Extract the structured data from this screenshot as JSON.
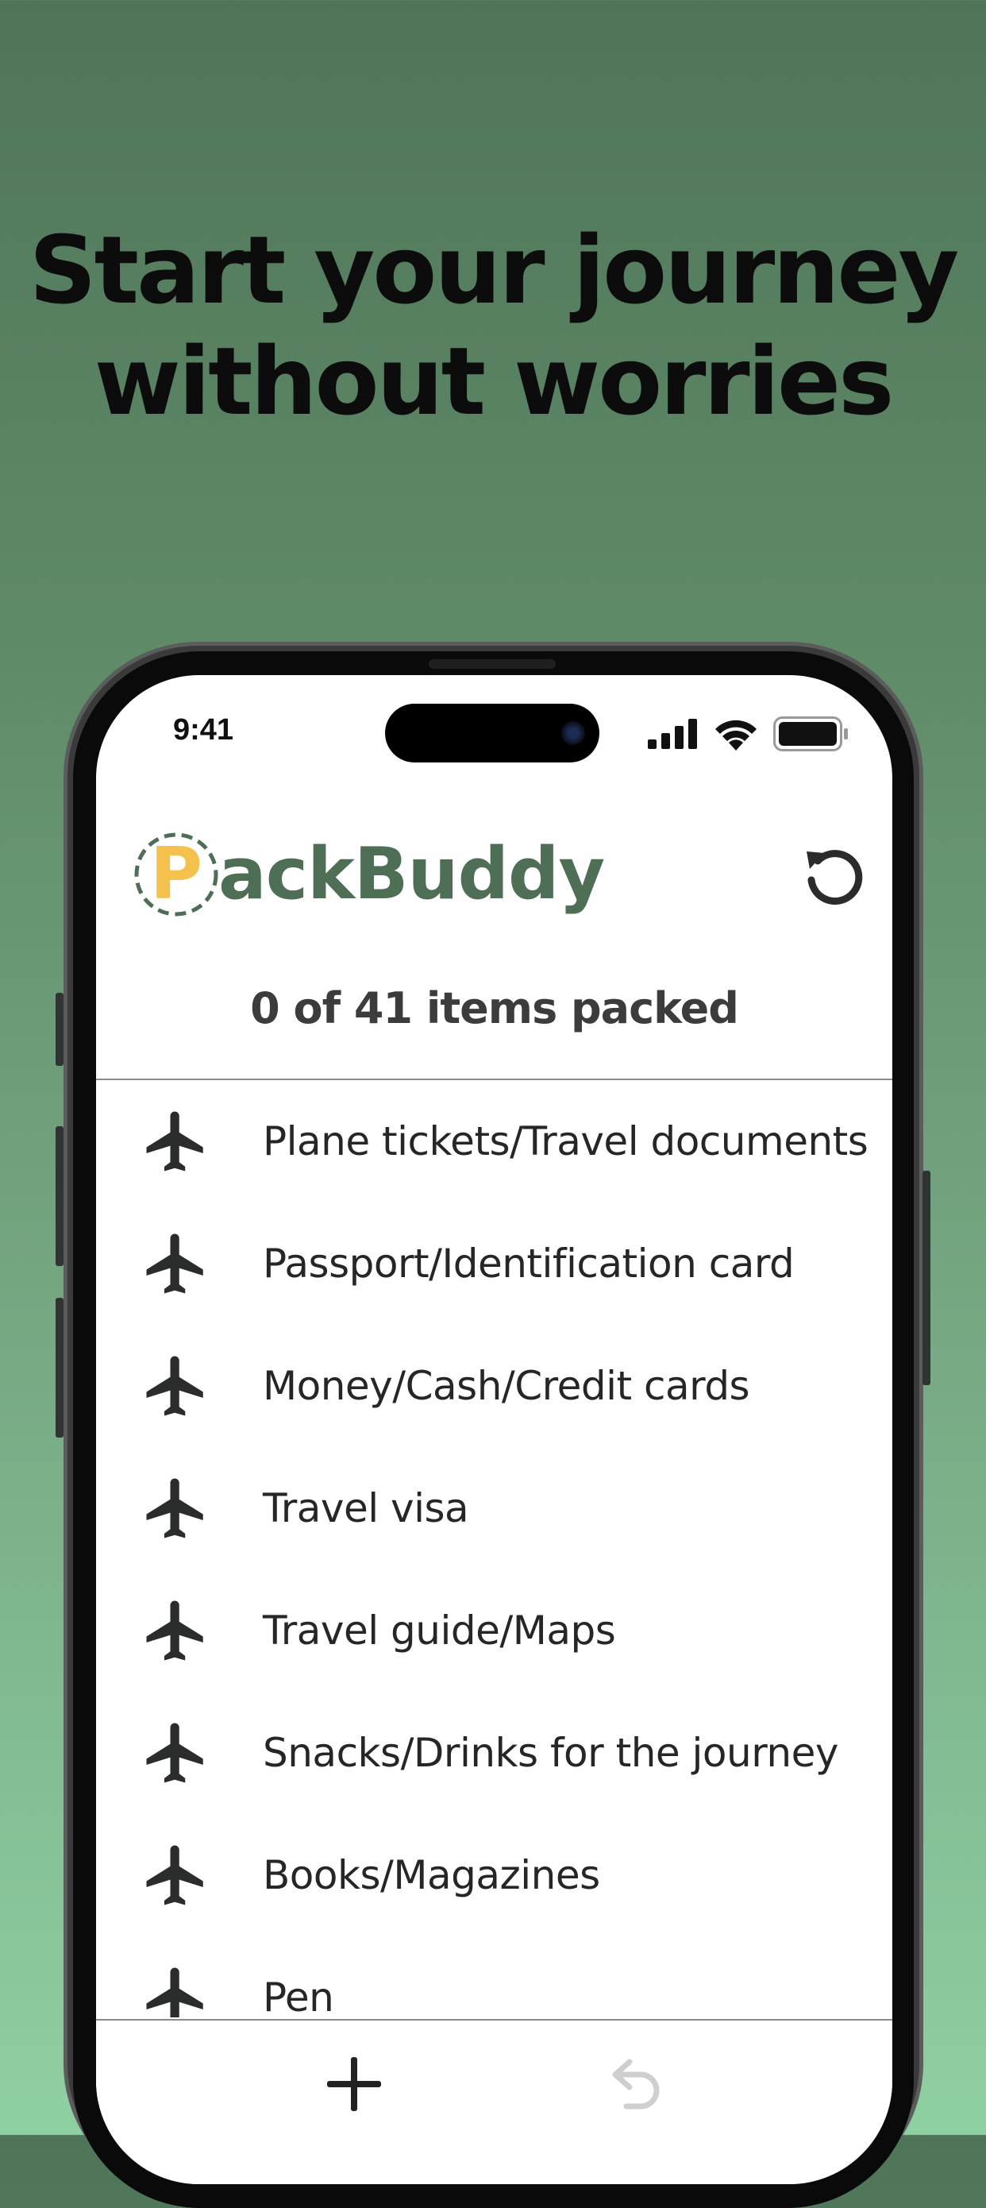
{
  "headline": {
    "line1": "Start your journey",
    "line2": "without worries"
  },
  "status_bar": {
    "time": "9:41"
  },
  "app": {
    "logo": {
      "initial": "P",
      "rest": "ackBuddy"
    },
    "packed_count_text": "0 of 41 items packed"
  },
  "items": [
    {
      "label": "Plane tickets/Travel documents",
      "icon": "airplane-icon"
    },
    {
      "label": "Passport/Identification card",
      "icon": "airplane-icon"
    },
    {
      "label": "Money/Cash/Credit cards",
      "icon": "airplane-icon"
    },
    {
      "label": "Travel visa",
      "icon": "airplane-icon"
    },
    {
      "label": "Travel guide/Maps",
      "icon": "airplane-icon"
    },
    {
      "label": "Snacks/Drinks for the journey",
      "icon": "airplane-icon"
    },
    {
      "label": "Books/Magazines",
      "icon": "airplane-icon"
    },
    {
      "label": "Pen",
      "icon": "airplane-icon"
    }
  ],
  "toolbar": {
    "add_icon": "plus-icon",
    "undo_icon": "undo-icon",
    "reset_icon": "reset-icon"
  },
  "colors": {
    "brand_green": "#4e6f56",
    "brand_yellow": "#f4c24c",
    "background_top": "#4f7559",
    "background_bottom": "#8fd0a2"
  }
}
